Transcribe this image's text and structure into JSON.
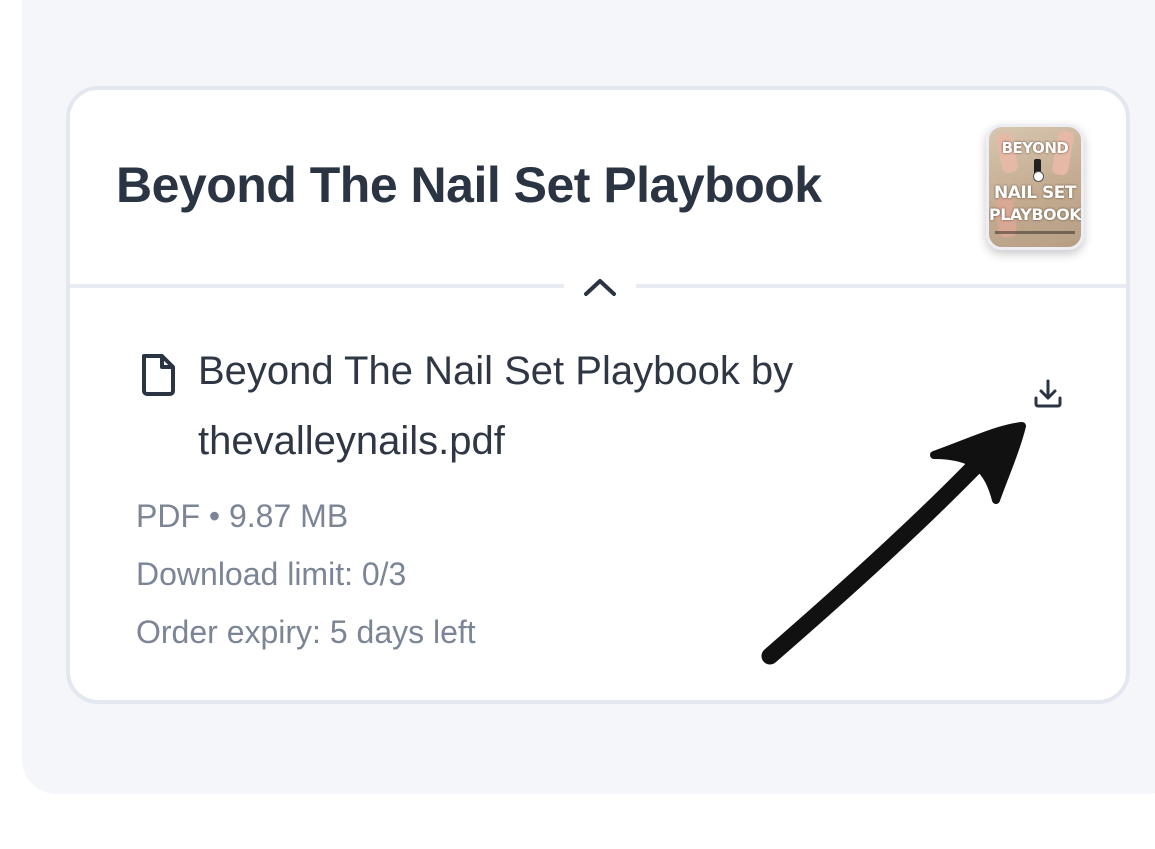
{
  "product": {
    "title": "Beyond The Nail Set Playbook",
    "cover": {
      "line1": "BEYOND",
      "line2": "NAIL SET",
      "line3": "PLAYBOOK"
    }
  },
  "file": {
    "icon": "file-icon",
    "name": "Beyond The Nail Set Playbook by thevalleynails.pdf",
    "type": "PDF",
    "separator": "•",
    "size": "9.87 MB",
    "download_limit": "Download limit: 0/3",
    "expiry": "Order expiry: 5 days left",
    "download_icon": "download-icon"
  },
  "toggle_icon": "chevron-up-icon",
  "annotation_icon": "arrow-annotation-icon",
  "colors": {
    "title": "#2b3443",
    "meta": "#7b8596",
    "card_border": "#e3e7f0",
    "panel_bg": "#f5f6fa"
  }
}
